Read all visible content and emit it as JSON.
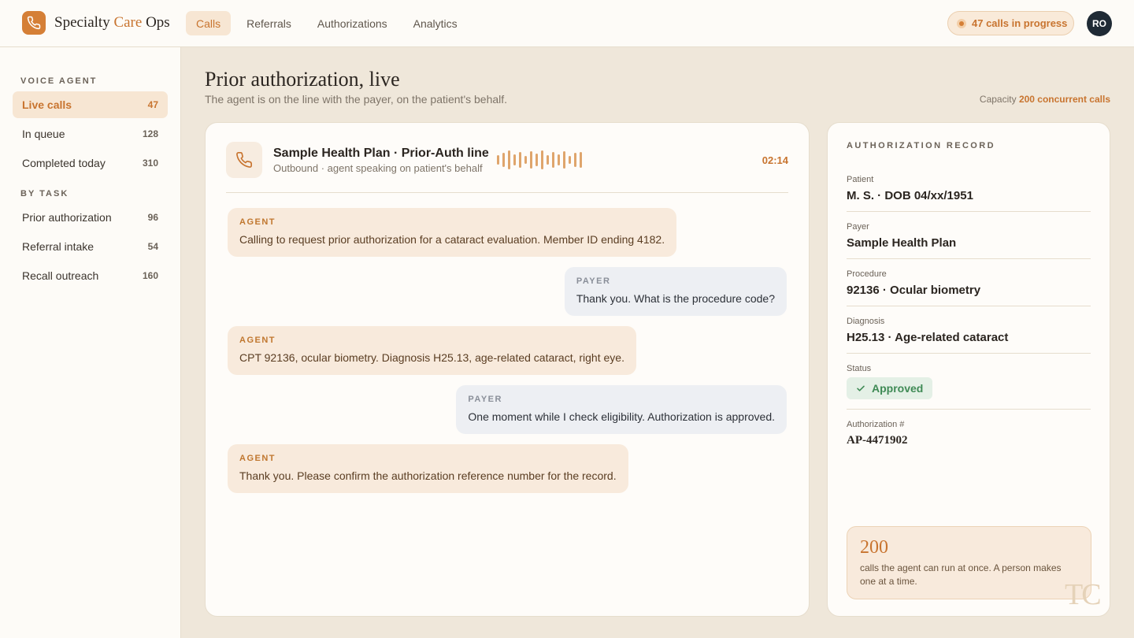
{
  "app": {
    "name_prefix": "Specialty",
    "name_accent": "Care",
    "name_suffix": "Ops",
    "brand_color": "#d57f36",
    "logo_icon": "phone-icon"
  },
  "nav": {
    "items": [
      {
        "label": "Calls",
        "active": true
      },
      {
        "label": "Referrals",
        "active": false
      },
      {
        "label": "Authorizations",
        "active": false
      },
      {
        "label": "Analytics",
        "active": false
      }
    ]
  },
  "status_pill": {
    "text": "47 calls in progress"
  },
  "user": {
    "initials": "RO"
  },
  "sidebar": {
    "voice_agent_label": "VOICE AGENT",
    "voice_agent_items": [
      {
        "label": "Live calls",
        "count": "47",
        "active": true
      },
      {
        "label": "In queue",
        "count": "128"
      },
      {
        "label": "Completed today",
        "count": "310"
      }
    ],
    "by_task_label": "BY TASK",
    "by_task_items": [
      {
        "label": "Prior authorization",
        "count": "96"
      },
      {
        "label": "Referral intake",
        "count": "54"
      },
      {
        "label": "Recall outreach",
        "count": "160"
      }
    ]
  },
  "header": {
    "title": "Prior authorization, live",
    "subtitle": "The agent is on the line with the payer, on the patient's behalf.",
    "capacity_label": "Capacity",
    "capacity_value": "200 concurrent calls"
  },
  "call": {
    "icon": "phone-icon",
    "title": "Sample Health Plan · Prior-Auth line",
    "subtitle": "Outbound · agent speaking on patient's behalf",
    "timer": "02:14",
    "transcript": [
      {
        "speaker": "AGENT",
        "role": "agent",
        "text": "Calling to request prior authorization for a cataract evaluation. Member ID ending 4182."
      },
      {
        "speaker": "PAYER",
        "role": "payer",
        "text": "Thank you. What is the procedure code?"
      },
      {
        "speaker": "AGENT",
        "role": "agent",
        "text": "CPT 92136, ocular biometry. Diagnosis H25.13, age-related cataract, right eye."
      },
      {
        "speaker": "PAYER",
        "role": "payer",
        "text": "One moment while I check eligibility. Authorization is approved."
      },
      {
        "speaker": "AGENT",
        "role": "agent",
        "text": "Thank you. Please confirm the authorization reference number for the record."
      }
    ]
  },
  "record": {
    "header": "AUTHORIZATION RECORD",
    "patient_label": "Patient",
    "patient_value": "M. S. · DOB 04/xx/1951",
    "payer_label": "Payer",
    "payer_value": "Sample Health Plan",
    "procedure_label": "Procedure",
    "procedure_value": "92136 · Ocular biometry",
    "diagnosis_label": "Diagnosis",
    "diagnosis_value": "H25.13 · Age-related cataract",
    "status_label": "Status",
    "status_value": "Approved",
    "status_color": "#3f8a55",
    "auth_label": "Authorization #",
    "auth_value": "AP-4471902"
  },
  "stat_card": {
    "number": "200",
    "description": "calls the agent can run at once. A person makes one at a time."
  },
  "watermark": "TC"
}
